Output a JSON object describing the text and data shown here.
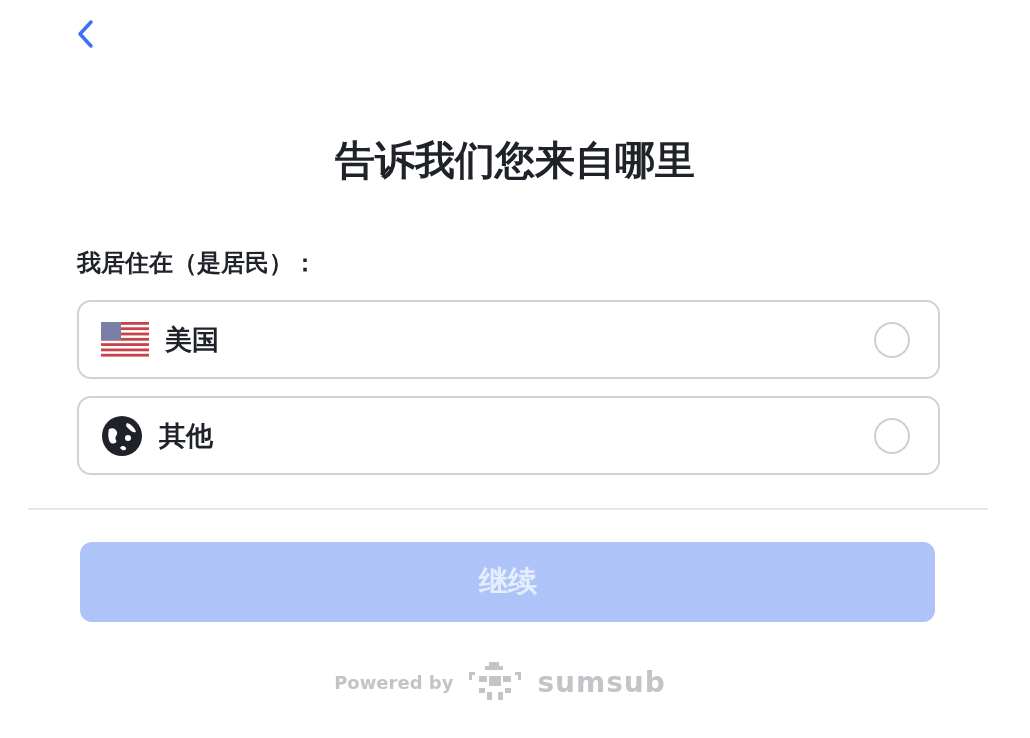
{
  "title": "告诉我们您来自哪里",
  "label": "我居住在（是居民）：",
  "options": [
    {
      "kind": "flag",
      "label": "美国",
      "selected": false
    },
    {
      "kind": "globe",
      "label": "其他",
      "selected": false
    }
  ],
  "continue_button": {
    "label": "继续",
    "disabled": true
  },
  "footer": {
    "powered_by": "Powered by",
    "brand": "sumsub"
  }
}
